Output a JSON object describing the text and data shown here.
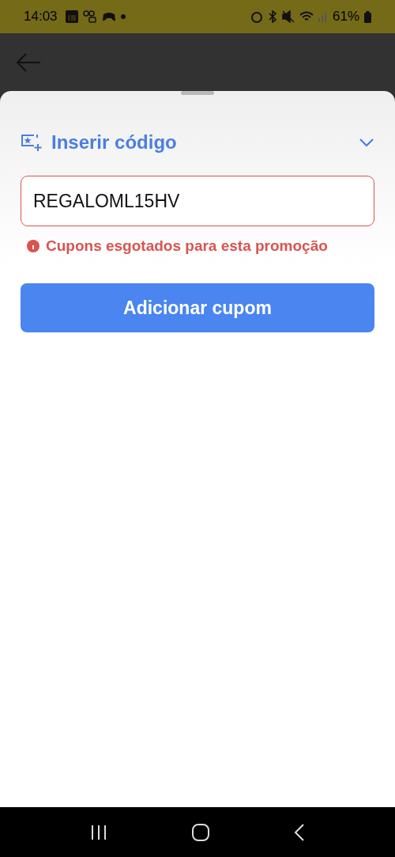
{
  "status_bar": {
    "time": "14:03",
    "battery": "61%"
  },
  "coupon_sheet": {
    "title": "Inserir código",
    "field": {
      "value": "REGALOML15HV",
      "invalid": true
    },
    "error": "Cupons esgotados para esta promoção",
    "button": "Adicionar cupom"
  }
}
